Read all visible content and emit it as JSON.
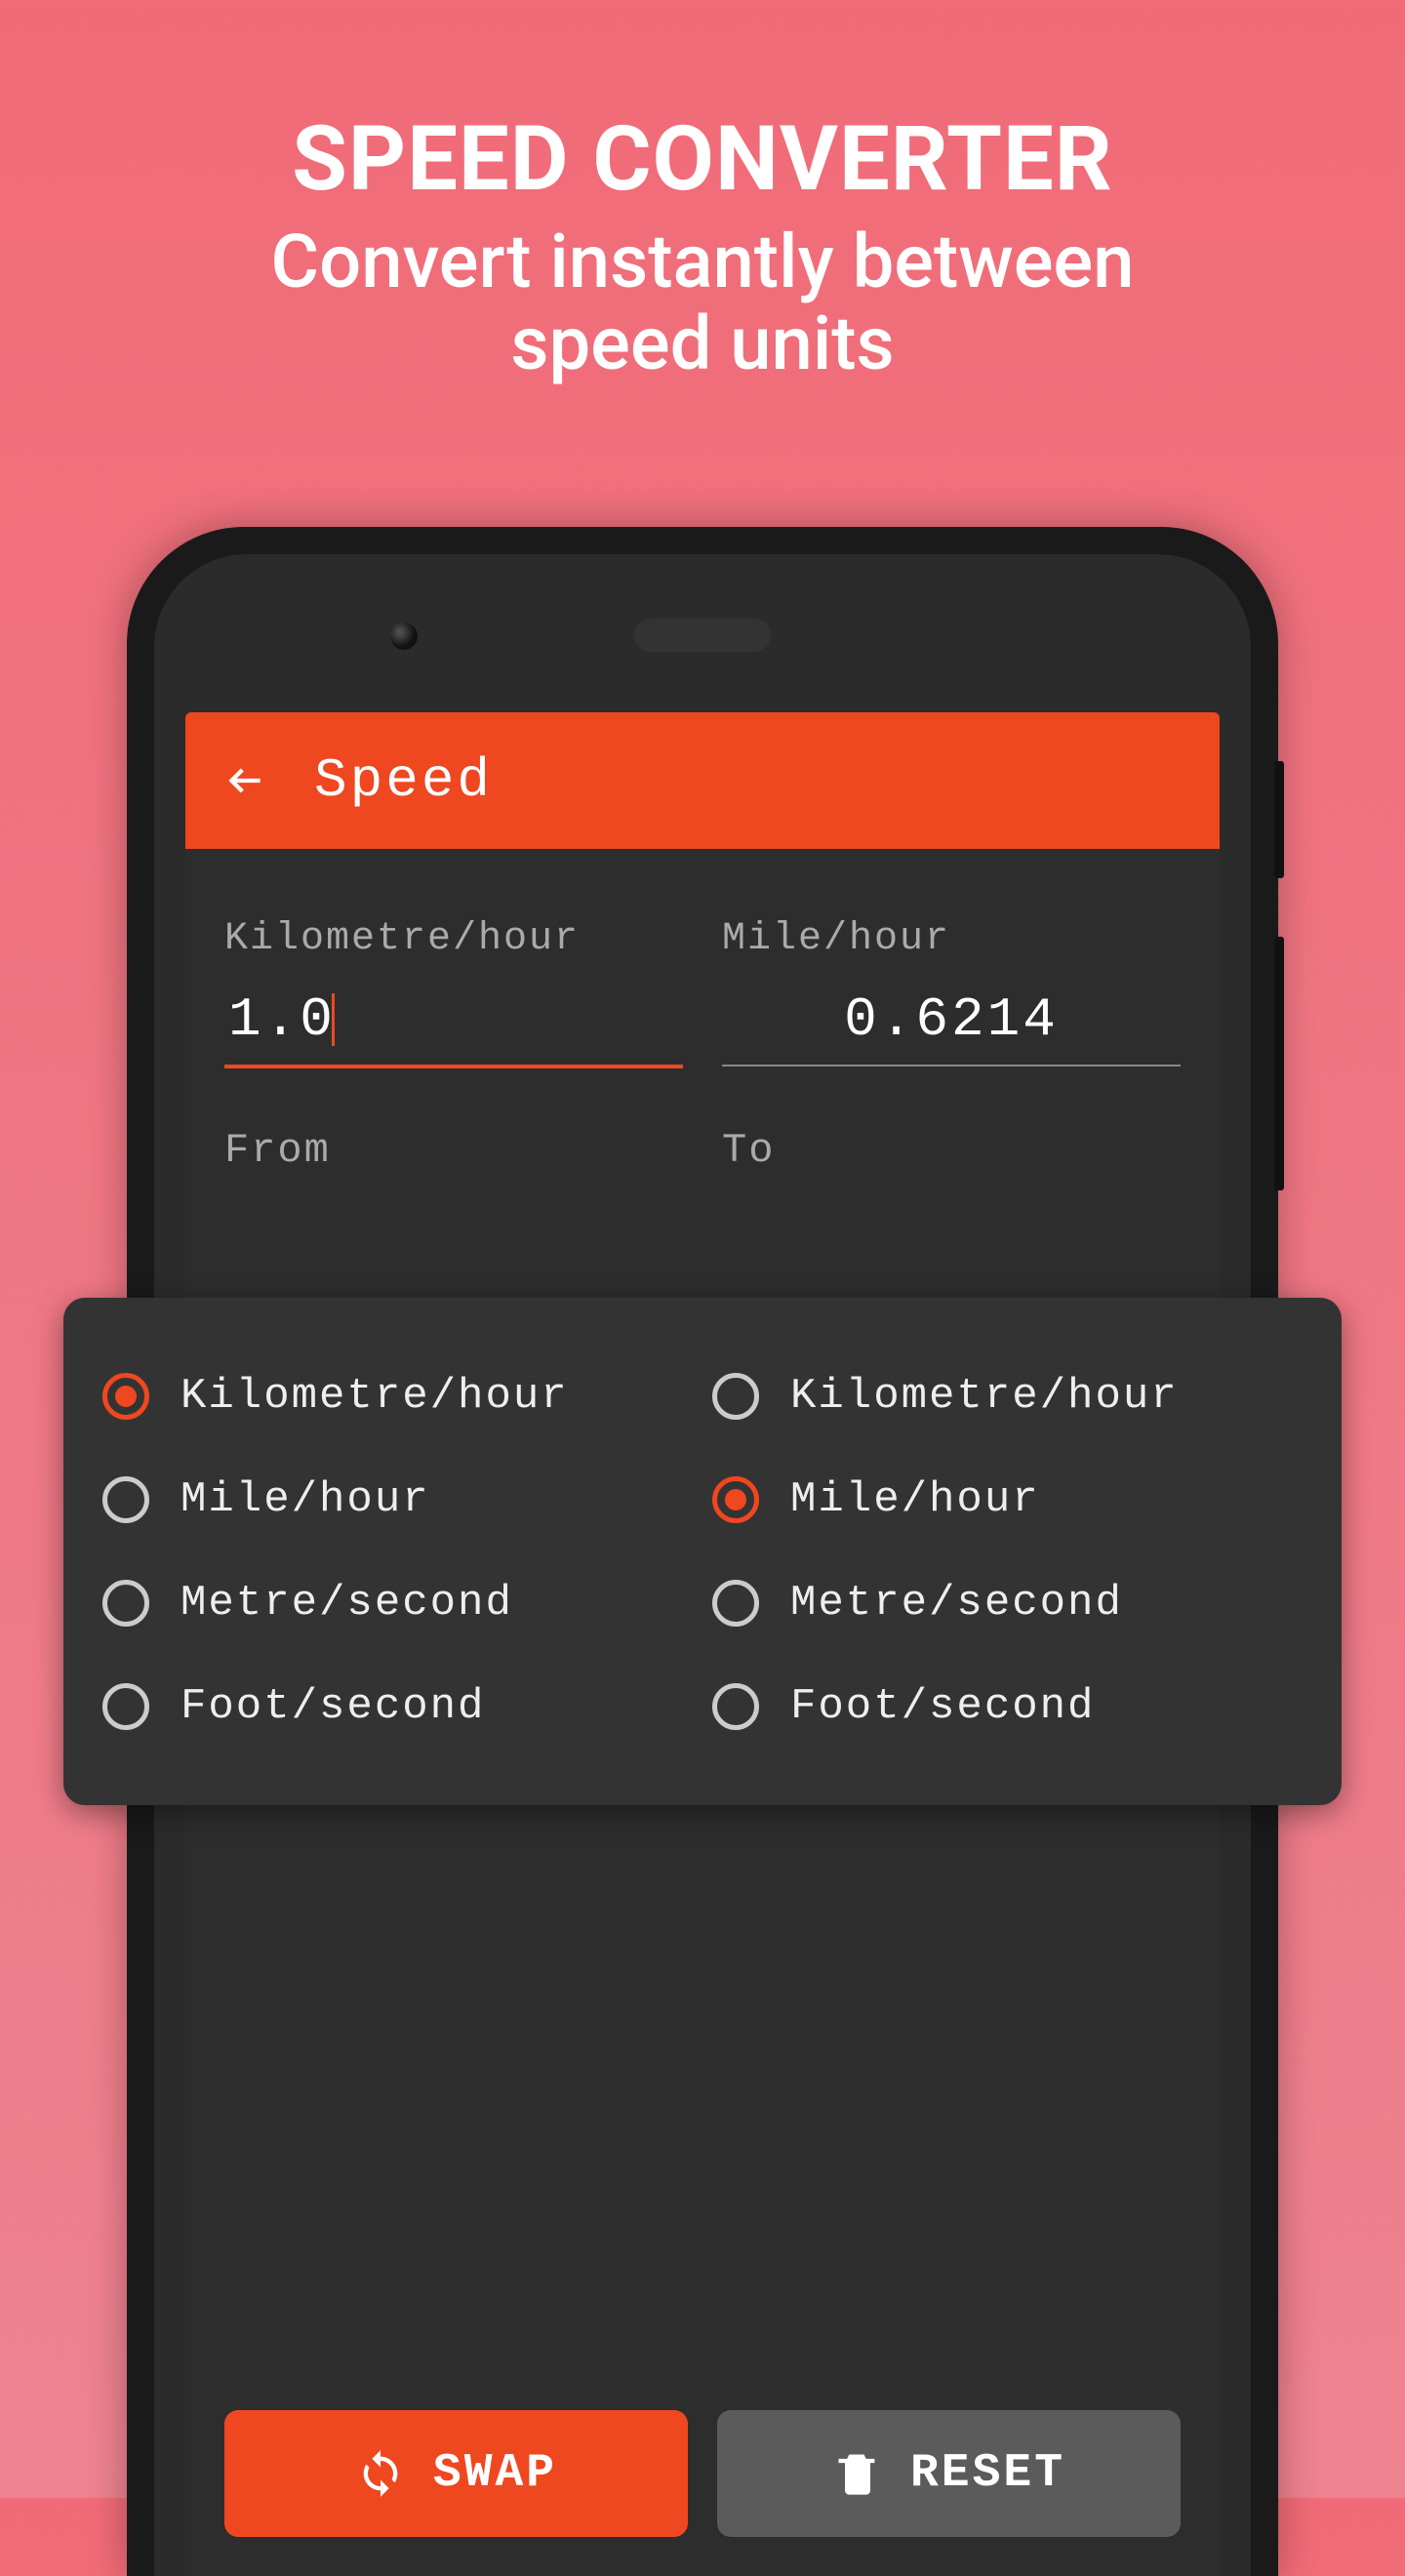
{
  "promo": {
    "title": "SPEED CONVERTER",
    "subtitle_line1": "Convert instantly between",
    "subtitle_line2": "speed units"
  },
  "app": {
    "title": "Speed"
  },
  "from": {
    "label": "Kilometre/hour",
    "value": "1.0",
    "heading": "From"
  },
  "to": {
    "label": "Mile/hour",
    "value": "0.6214",
    "heading": "To"
  },
  "units": {
    "from": [
      {
        "label": "Kilometre/hour",
        "selected": true
      },
      {
        "label": "Mile/hour",
        "selected": false
      },
      {
        "label": "Metre/second",
        "selected": false
      },
      {
        "label": "Foot/second",
        "selected": false
      }
    ],
    "to": [
      {
        "label": "Kilometre/hour",
        "selected": false
      },
      {
        "label": "Mile/hour",
        "selected": true
      },
      {
        "label": "Metre/second",
        "selected": false
      },
      {
        "label": "Foot/second",
        "selected": false
      }
    ]
  },
  "buttons": {
    "swap": "SWAP",
    "reset": "RESET"
  },
  "colors": {
    "accent": "#ef4720",
    "bg": "#2d2d2d"
  }
}
